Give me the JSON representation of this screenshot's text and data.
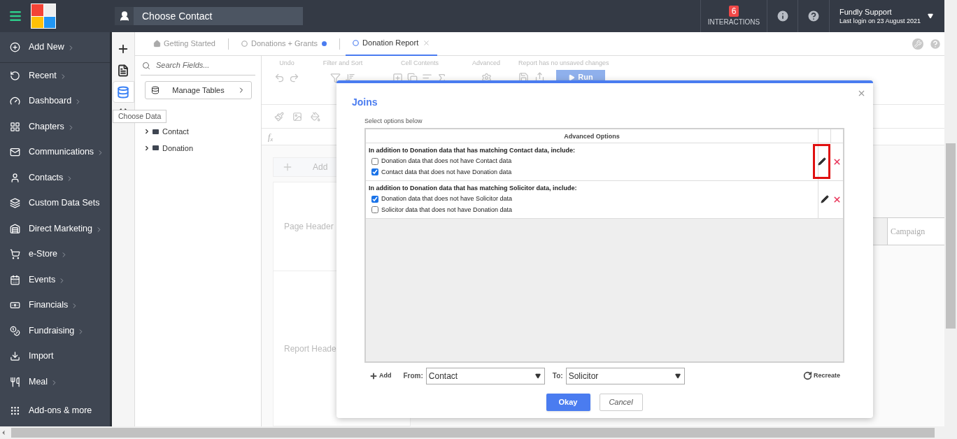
{
  "header": {
    "contact_picker": {
      "label": "Choose Contact"
    },
    "interactions": {
      "count": "6",
      "label": "INTERACTIONS"
    },
    "user": {
      "name": "Fundly Support",
      "last_login": "Last login on 23 August 2021"
    }
  },
  "sidebar": {
    "items": [
      {
        "label": "Add New",
        "has_submenu": true
      },
      {
        "label": "Recent",
        "has_submenu": true
      },
      {
        "label": "Dashboard",
        "has_submenu": true
      },
      {
        "label": "Chapters",
        "has_submenu": true
      },
      {
        "label": "Communications",
        "has_submenu": true
      },
      {
        "label": "Contacts",
        "has_submenu": true
      },
      {
        "label": "Custom Data Sets",
        "has_submenu": false
      },
      {
        "label": "Direct Marketing",
        "has_submenu": true
      },
      {
        "label": "e-Store",
        "has_submenu": true
      },
      {
        "label": "Events",
        "has_submenu": true
      },
      {
        "label": "Financials",
        "has_submenu": true
      },
      {
        "label": "Fundraising",
        "has_submenu": true
      },
      {
        "label": "Import",
        "has_submenu": false
      },
      {
        "label": "Meal",
        "has_submenu": true
      },
      {
        "label": "Add-ons & more",
        "has_submenu": false
      }
    ]
  },
  "rail": {
    "buttons": [
      {
        "selected": false
      },
      {
        "selected": false
      },
      {
        "selected": true
      },
      {
        "selected": false
      }
    ],
    "tooltip": "Choose Data"
  },
  "tabs": [
    {
      "label": "Getting Started",
      "kind": "home",
      "selected": false,
      "unsaved": false
    },
    {
      "label": "Donations + Grants",
      "kind": "report",
      "selected": false,
      "unsaved": true
    },
    {
      "label": "Donation Report",
      "kind": "report",
      "selected": true,
      "unsaved": false
    }
  ],
  "fields_panel": {
    "search": {
      "placeholder": "Search Fields..."
    },
    "manage_tables": "Manage Tables",
    "tree": [
      {
        "label": "Contact",
        "expanded": false
      },
      {
        "label": "Donation",
        "expanded": false
      }
    ]
  },
  "toolbar": {
    "groups": [
      "Undo",
      "Filter and Sort",
      "Cell Contents",
      "Advanced"
    ],
    "status": "Report has no unsaved changes",
    "run": "Run",
    "formula_label": "f$_{x}$"
  },
  "report": {
    "add": "Add",
    "sections": [
      "Page Header",
      "Report Heade"
    ],
    "columns": [
      "Campaign"
    ]
  },
  "dialog": {
    "title": "Joins",
    "subtitle": "Select options below",
    "table_header": "Advanced Options",
    "joins": [
      {
        "heading": "In addition to Donation data that has matching Contact data, include:",
        "highlighted": true,
        "options": [
          {
            "label": "Donation data that does not have Contact data",
            "checked": false
          },
          {
            "label": "Contact data that does not have Donation data",
            "checked": true
          }
        ]
      },
      {
        "heading": "In addition to Donation data that has matching Solicitor data, include:",
        "highlighted": false,
        "options": [
          {
            "label": "Donation data that does not have Solicitor data",
            "checked": true
          },
          {
            "label": "Solicitor data that does not have Donation data",
            "checked": false
          }
        ]
      }
    ],
    "add": "Add",
    "from": {
      "label": "From:",
      "value": "Contact"
    },
    "to": {
      "label": "To:",
      "value": "Solicitor"
    },
    "recreate": "Recreate",
    "buttons": {
      "ok": "Okay",
      "cancel": "Cancel"
    }
  }
}
